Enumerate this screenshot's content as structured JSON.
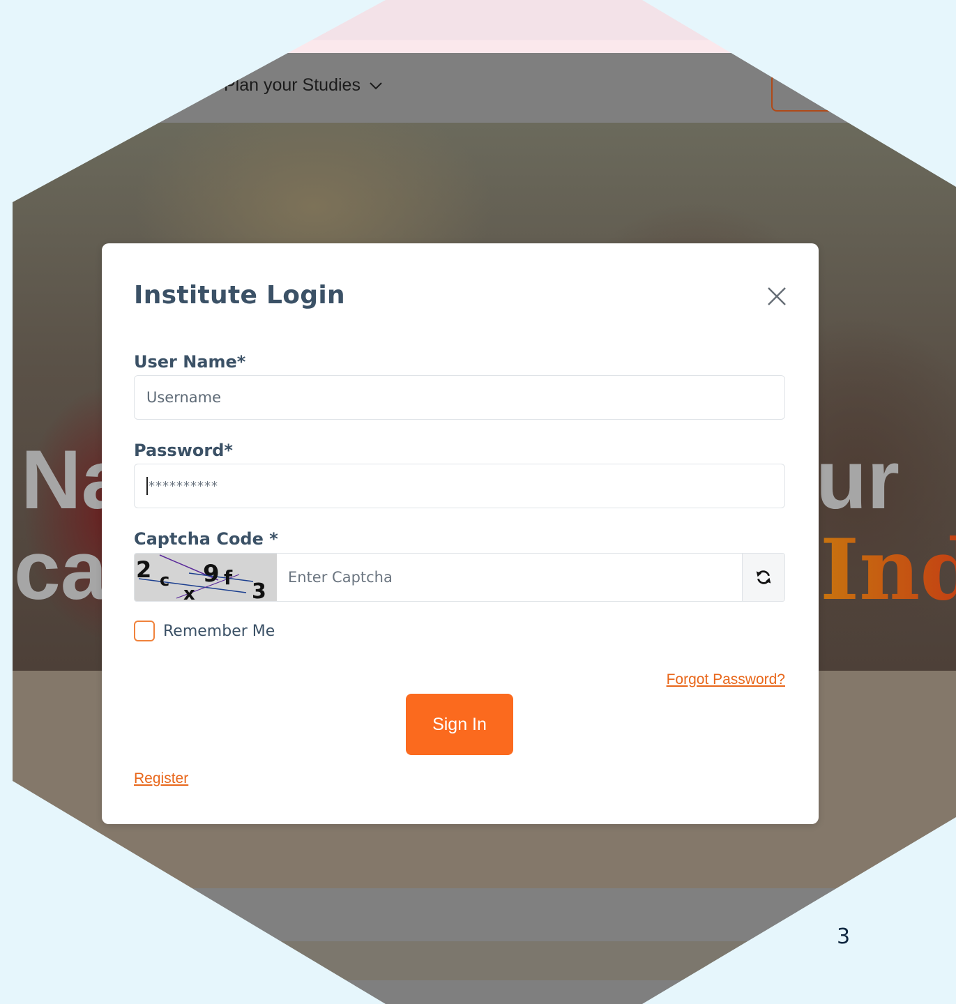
{
  "background": {
    "nav_item_label": "Plan your Studies",
    "hero_word_left_1": "Na",
    "hero_word_left_2": "ca",
    "hero_word_right_1": "ur",
    "hero_word_right_2": "Ind",
    "page_number": "3"
  },
  "modal": {
    "title": "Institute Login",
    "username_label": "User Name*",
    "username_placeholder": "Username",
    "password_label": "Password*",
    "password_value": "**********",
    "captcha_label": "Captcha Code *",
    "captcha_code": "2cx9f3",
    "captcha_placeholder": "Enter Captcha",
    "remember_label": "Remember Me",
    "remember_checked": false,
    "forgot_label": "Forgot Password?",
    "signin_label": "Sign In",
    "register_label": "Register"
  },
  "colors": {
    "accent": "#fb6a1e",
    "link": "#e8671b",
    "title_text": "#3b5166",
    "frame_background": "#e6f6fc"
  },
  "icons": {
    "close": "close-icon",
    "refresh": "refresh-icon",
    "dropdown": "chevron-down-icon"
  }
}
